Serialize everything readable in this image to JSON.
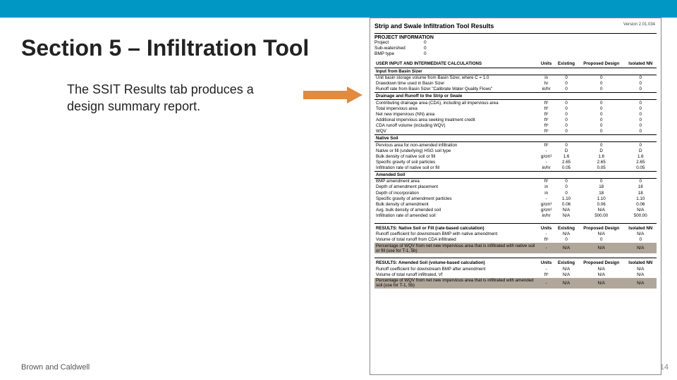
{
  "slide": {
    "title": "Section 5 – Infiltration Tool",
    "body": "The SSIT Results tab produces a design summary report.",
    "footer_left": "Brown and Caldwell",
    "page_number": "14"
  },
  "report": {
    "title": "Strip and Swale Infiltration Tool Results",
    "version": "Version 2.01.034",
    "project_info": {
      "header": "PROJECT INFORMATION",
      "rows": [
        {
          "label": "Project",
          "value": "0"
        },
        {
          "label": "Sub-watershed",
          "value": "0"
        },
        {
          "label": "BMP type",
          "value": "0"
        }
      ]
    },
    "col_headers": {
      "main": "USER INPUT AND INTERMEDIATE CALCULATIONS",
      "units": "Units",
      "existing": "Existing",
      "proposed": "Proposed Design",
      "isolated": "Isolated NN"
    },
    "sections": [
      {
        "name": "Input from Basin Sizer",
        "rows": [
          {
            "label": "Unit basin storage volume from Basin Sizer, where C = 1.0",
            "units": "in",
            "existing": "0",
            "proposed": "0",
            "isolated": "0"
          },
          {
            "label": "Drawdown time used in Basin Sizer",
            "units": "hr",
            "existing": "0",
            "proposed": "0",
            "isolated": "0"
          },
          {
            "label": "Runoff rate from Basin Sizer \"Calibrate Water Quality Flows\"",
            "units": "in/hr",
            "existing": "0",
            "proposed": "0",
            "isolated": "0"
          }
        ]
      },
      {
        "name": "Drainage and Runoff to the Strip or Swale",
        "rows": [
          {
            "label": "Contributing drainage area (CDA), including all impervious area",
            "units": "ft²",
            "existing": "0",
            "proposed": "0",
            "isolated": "0"
          },
          {
            "label": "Total impervious area",
            "units": "ft²",
            "existing": "0",
            "proposed": "0",
            "isolated": "0"
          },
          {
            "label": "Net new impervious (NN) area",
            "units": "ft²",
            "existing": "0",
            "proposed": "0",
            "isolated": "0"
          },
          {
            "label": "Additional impervious area seeking treatment credit",
            "units": "ft²",
            "existing": "0",
            "proposed": "0",
            "isolated": "0"
          },
          {
            "label": "CDA runoff volume (including WQV)",
            "units": "ft³",
            "existing": "0",
            "proposed": "0",
            "isolated": "0"
          },
          {
            "label": "WQV",
            "units": "ft³",
            "existing": "0",
            "proposed": "0",
            "isolated": "0"
          }
        ]
      },
      {
        "name": "Native Soil",
        "rows": [
          {
            "label": "Pervious area for non-amended infiltration",
            "units": "ft²",
            "existing": "0",
            "proposed": "0",
            "isolated": "0"
          },
          {
            "label": "Native or fill (underlying) HSG soil type",
            "units": "-",
            "existing": "D",
            "proposed": "D",
            "isolated": "D"
          },
          {
            "label": "Bulk density of native soil or fill",
            "units": "g/cm³",
            "existing": "1.6",
            "proposed": "1.6",
            "isolated": "1.6"
          },
          {
            "label": "Specific gravity of soil particles",
            "units": "-",
            "existing": "2.65",
            "proposed": "2.65",
            "isolated": "2.65"
          },
          {
            "label": "Infiltration rate of native soil or fill",
            "units": "in/hr",
            "existing": "0.05",
            "proposed": "0.05",
            "isolated": "0.05"
          }
        ]
      },
      {
        "name": "Amended Soil",
        "rows": [
          {
            "label": "BMP amendment area",
            "units": "ft²",
            "existing": "0",
            "proposed": "0",
            "isolated": "0"
          },
          {
            "label": "Depth of amendment placement",
            "units": "in",
            "existing": "0",
            "proposed": "18",
            "isolated": "18"
          },
          {
            "label": "Depth of incorporation",
            "units": "in",
            "existing": "0",
            "proposed": "18",
            "isolated": "18"
          },
          {
            "label": "Specific gravity of amendment particles",
            "units": "-",
            "existing": "1.10",
            "proposed": "1.10",
            "isolated": "1.10"
          },
          {
            "label": "Bulk density of amendment",
            "units": "g/cm³",
            "existing": "0.06",
            "proposed": "0.06",
            "isolated": "0.06"
          },
          {
            "label": "Avg. bulk density of amended soil",
            "units": "g/cm³",
            "existing": "N/A",
            "proposed": "N/A",
            "isolated": "N/A"
          },
          {
            "label": "Infiltration rate of amended soil",
            "units": "in/hr",
            "existing": "N/A",
            "proposed": "500.00",
            "isolated": "500.00"
          }
        ]
      }
    ],
    "results_native": {
      "header": "RESULTS: Native Soil or Fill (rate-based calculation)",
      "units": "Units",
      "existing": "Existing",
      "proposed": "Proposed Design",
      "isolated": "Isolated NN",
      "rows": [
        {
          "label": "Runoff coefficient for downstream BMP with native amendment",
          "units": "-",
          "existing": "N/A",
          "proposed": "N/A",
          "isolated": "N/A"
        },
        {
          "label": "Volume of total runoff from CDA infiltrated",
          "units": "ft³",
          "existing": "0",
          "proposed": "0",
          "isolated": "0"
        },
        {
          "label": "Percentage of WQV from net new impervious area that is infiltrated with native soil or fill (use for T-1, 5b)",
          "units": "-",
          "existing": "N/A",
          "proposed": "N/A",
          "isolated": "N/A",
          "shaded": true
        }
      ]
    },
    "results_amended": {
      "header": "RESULTS: Amended Soil (volume-based calculation)",
      "units": "Units",
      "existing": "Existing",
      "proposed": "Proposed Design",
      "isolated": "Isolated NN",
      "rows": [
        {
          "label": "Runoff coefficient for downstream BMP after amendment",
          "units": "-",
          "existing": "N/A",
          "proposed": "N/A",
          "isolated": "N/A"
        },
        {
          "label": "Volume of total runoff infiltrated, Vf",
          "units": "ft³",
          "existing": "N/A",
          "proposed": "N/A",
          "isolated": "N/A"
        },
        {
          "label": "Percentage of WQV from net new impervious area that is infiltrated with amended soil (use for T-1, 5b)",
          "units": "-",
          "existing": "N/A",
          "proposed": "N/A",
          "isolated": "N/A",
          "shaded": true
        }
      ]
    }
  }
}
